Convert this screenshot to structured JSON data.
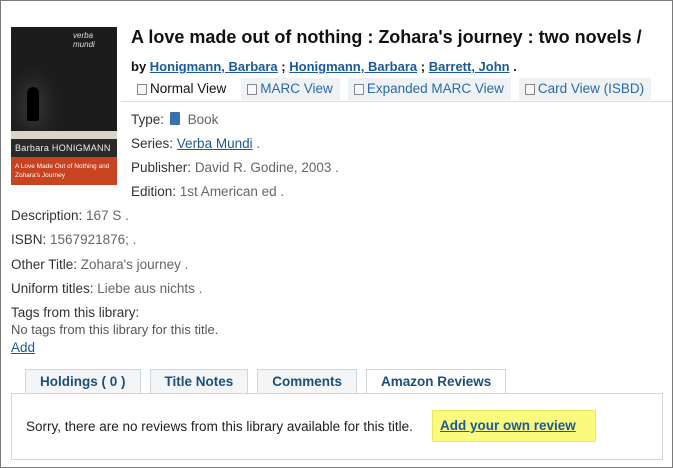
{
  "title": "A love made out of nothing : Zohara's journey : two novels /",
  "byline": {
    "prefix": "by",
    "authors": [
      "Honigmann, Barbara",
      "Honigmann, Barbara",
      "Barrett, John"
    ],
    "sep": ";",
    "end": "."
  },
  "cover": {
    "publisher_mark": "verba mundi",
    "author": "Barbara HONIGMANN",
    "subtitle": "A Love Made Out of Nothing and Zohara's Journey"
  },
  "view_tabs": [
    {
      "label": "Normal View",
      "active": true
    },
    {
      "label": "MARC View",
      "active": false
    },
    {
      "label": "Expanded MARC View",
      "active": false
    },
    {
      "label": "Card View (ISBD)",
      "active": false
    }
  ],
  "fields": {
    "type": {
      "label": "Type:",
      "value": "Book"
    },
    "series": {
      "label": "Series:",
      "value": "Verba Mundi",
      "suffix": "."
    },
    "publisher": {
      "label": "Publisher:",
      "value": "David R. Godine, 2003 ."
    },
    "edition": {
      "label": "Edition:",
      "value": "1st American ed ."
    },
    "description": {
      "label": "Description:",
      "value": "167 S ."
    },
    "isbn": {
      "label": "ISBN:",
      "value": "1567921876; ."
    },
    "other_title": {
      "label": "Other Title:",
      "value": "Zohara's journey ."
    },
    "uniform_titles": {
      "label": "Uniform titles:",
      "value": "Liebe aus nichts ."
    }
  },
  "tags": {
    "label": "Tags from this library:",
    "none": "No tags from this library for this title.",
    "add": "Add"
  },
  "bottom_tabs": [
    {
      "label": "Holdings ( 0 )",
      "active": false
    },
    {
      "label": "Title Notes",
      "active": false
    },
    {
      "label": "Comments",
      "active": false
    },
    {
      "label": "Amazon Reviews",
      "active": true
    }
  ],
  "reviews": {
    "message": "Sorry, there are no reviews from this library available for this title.",
    "add_link": "Add your own review",
    "highlight_color": "#fafa7c"
  }
}
